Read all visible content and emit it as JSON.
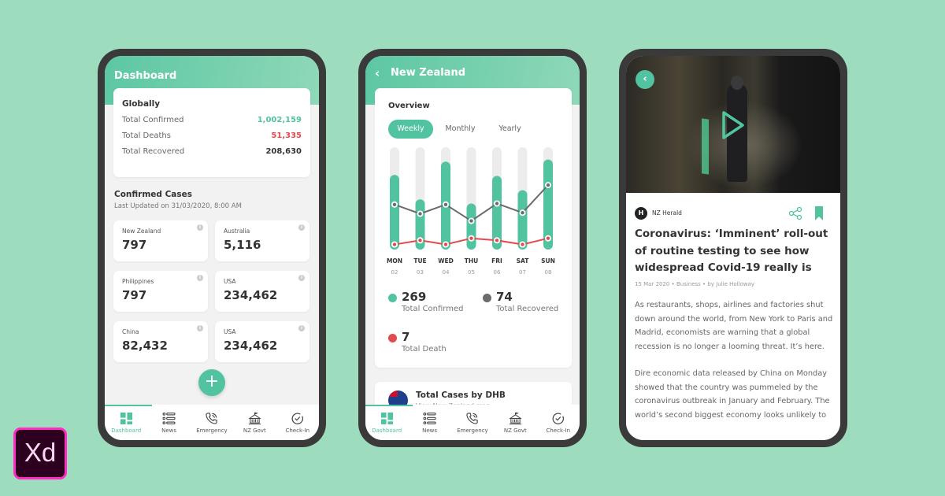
{
  "colors": {
    "background": "#9ddcbc",
    "accent": "#52c3a0",
    "death": "#e5484d",
    "recovered": "#6b6b6b",
    "frame": "#3a3a3a"
  },
  "tabbar": {
    "items": [
      {
        "label": "Dashboard",
        "icon": "dashboard-icon",
        "active": true
      },
      {
        "label": "News",
        "icon": "news-list-icon",
        "active": false
      },
      {
        "label": "Emergency",
        "icon": "phone-call-icon",
        "active": false
      },
      {
        "label": "NZ Govt",
        "icon": "government-building-icon",
        "active": false
      },
      {
        "label": "Check-In",
        "icon": "check-circle-icon",
        "active": false
      }
    ]
  },
  "dashboard": {
    "title": "Dashboard",
    "globally": {
      "title": "Globally",
      "rows": [
        {
          "label": "Total Confirmed",
          "value": "1,002,159"
        },
        {
          "label": "Total Deaths",
          "value": "51,335"
        },
        {
          "label": "Total Recovered",
          "value": "208,630"
        }
      ]
    },
    "confirmed": {
      "title": "Confirmed Cases",
      "updated": "Last Updated on 31/03/2020, 8:00 AM",
      "countries": [
        {
          "name": "New Zealand",
          "value": "797"
        },
        {
          "name": "Australia",
          "value": "5,116"
        },
        {
          "name": "Philippines",
          "value": "797"
        },
        {
          "name": "USA",
          "value": "234,462"
        },
        {
          "name": "China",
          "value": "82,432"
        },
        {
          "name": "USA",
          "value": "234,462"
        }
      ]
    },
    "fab_icon": "+"
  },
  "nz": {
    "title": "New Zealand",
    "back_icon": "‹",
    "overview_title": "Overview",
    "periods": [
      "Weekly",
      "Monthly",
      "Yearly"
    ],
    "active_period": "Weekly",
    "stats": [
      {
        "value": "269",
        "label": "Total Confirmed"
      },
      {
        "value": "74",
        "label": "Total Recovered"
      },
      {
        "value": "7",
        "label": "Total Death"
      }
    ],
    "dhb": {
      "title": "Total Cases by DHB",
      "subtitle": "View New Zealand map"
    }
  },
  "chart_data": {
    "type": "bar",
    "title": "Overview",
    "categories": [
      "MON",
      "TUE",
      "WED",
      "THU",
      "FRI",
      "SAT",
      "SUN"
    ],
    "dates": [
      "02",
      "03",
      "04",
      "05",
      "06",
      "07",
      "08"
    ],
    "ylim": [
      0,
      100
    ],
    "grid": false,
    "series": [
      {
        "name": "Total Confirmed",
        "kind": "bar",
        "color": "#52c3a0",
        "values": [
          73,
          49,
          86,
          45,
          72,
          58,
          88
        ]
      },
      {
        "name": "Total Recovered",
        "kind": "line",
        "color": "#6b6b6b",
        "values": [
          44,
          35,
          44,
          28,
          45,
          36,
          63
        ]
      },
      {
        "name": "Total Death",
        "kind": "line",
        "color": "#e5484d",
        "values": [
          5,
          9,
          5,
          11,
          9,
          5,
          11
        ]
      }
    ]
  },
  "article": {
    "publisher": "NZ Herald",
    "publisher_initial": "H",
    "headline": "Coronavirus: ‘Imminent’ roll-out of routine testing to see how widespread Covid-19 really is",
    "meta": "15 Mar 2020  •  Business  •  by Julie Holloway",
    "paragraphs": [
      "As restaurants, shops, airlines and factories shut down around the world, from New York to Paris and Madrid, economists are warning that a global recession is no longer a looming threat. It’s here.",
      "Dire economic data released by China on Monday showed that the country was pummeled by the coronavirus outbreak in January and February. The world’s second biggest economy looks unlikely to"
    ],
    "back_icon": "‹"
  },
  "badge": {
    "text": "Xd"
  }
}
